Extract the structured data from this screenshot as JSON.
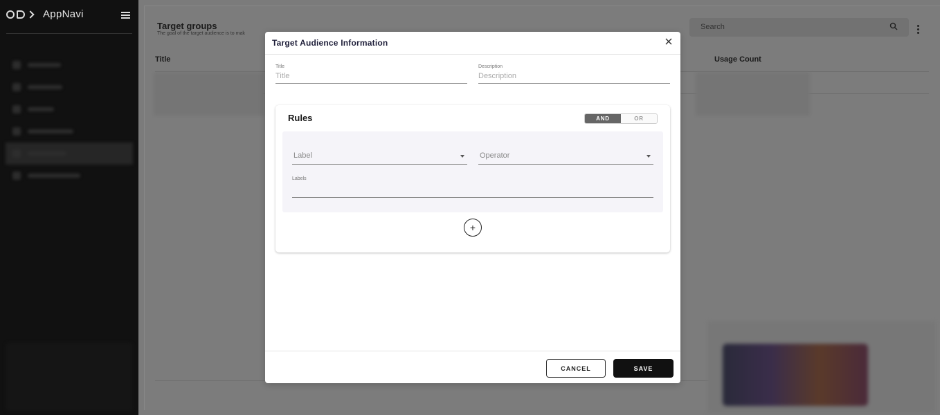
{
  "app": {
    "name": "AppNavi"
  },
  "page": {
    "title": "Target groups",
    "subtitle": "The goal of the target audience is to mak",
    "search_placeholder": "Search",
    "columns": {
      "title": "Title",
      "usage_count": "Usage Count"
    }
  },
  "modal": {
    "title": "Target Audience Information",
    "fields": {
      "title": {
        "label": "Title",
        "placeholder": "Title"
      },
      "description": {
        "label": "Description",
        "placeholder": "Description"
      }
    },
    "rules": {
      "heading": "Rules",
      "toggle": {
        "and": "AND",
        "or": "OR",
        "selected": "AND"
      },
      "label_select": "Label",
      "operator_select": "Operator",
      "labels_field": "Labels",
      "add_symbol": "+"
    },
    "buttons": {
      "cancel": "CANCEL",
      "save": "SAVE"
    }
  }
}
